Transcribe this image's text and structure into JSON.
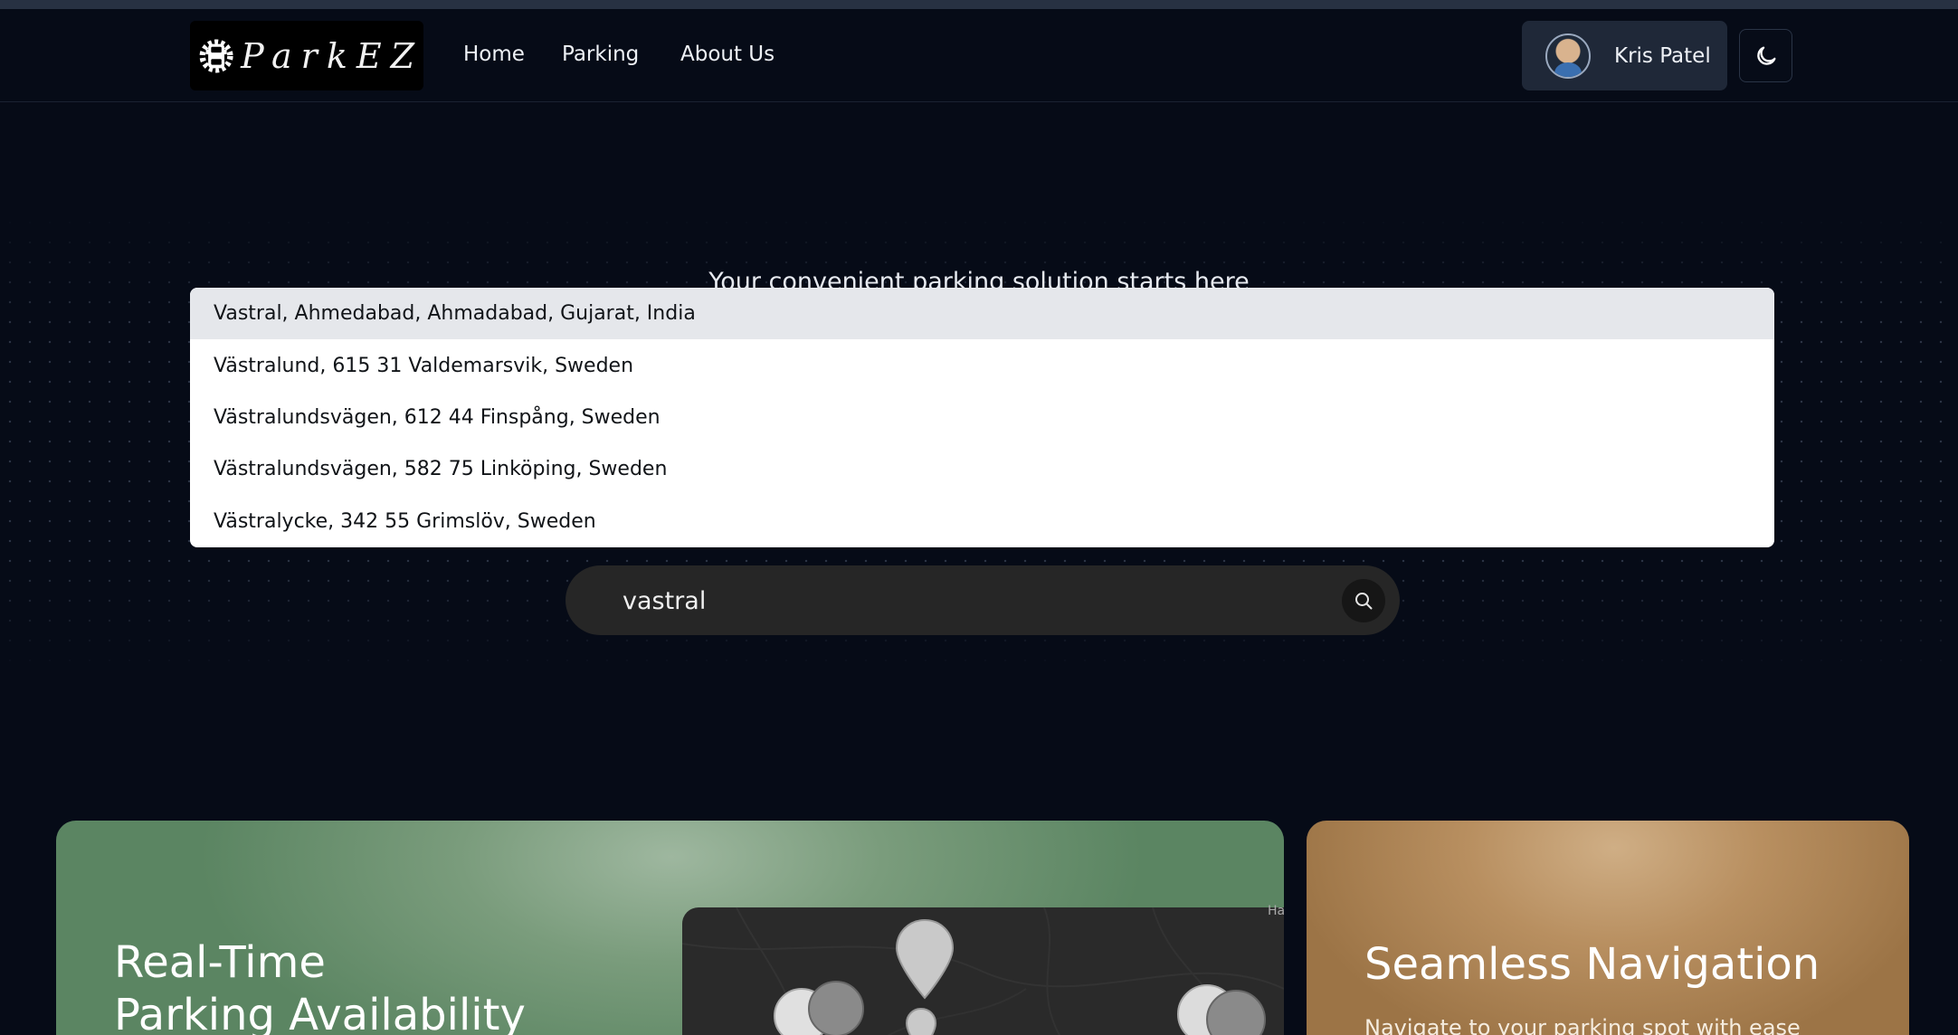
{
  "brand": {
    "logo_text": "ParkEZ"
  },
  "nav": {
    "items": [
      "Home",
      "Parking",
      "About Us"
    ]
  },
  "user": {
    "name": "Kris Patel"
  },
  "hero": {
    "tagline": "Your convenient parking solution starts here"
  },
  "search": {
    "value": "vastral",
    "suggestions": [
      "Vastral, Ahmedabad, Ahmadabad, Gujarat, India",
      "Västralund, 615 31 Valdemarsvik, Sweden",
      "Västralundsvägen, 612 44 Finspång, Sweden",
      "Västralundsvägen, 582 75 Linköping, Sweden",
      "Västralycke, 342 55 Grimslöv, Sweden"
    ]
  },
  "features": {
    "realtime": {
      "title_line1": "Real-Time",
      "title_line2": "Parking Availability",
      "map_attribution": "Ha"
    },
    "navigation": {
      "title": "Seamless Navigation",
      "description": "Navigate to your parking spot with ease"
    }
  },
  "colors": {
    "page_bg": "#060b17",
    "user_chip_bg": "#1f2838",
    "search_bg": "#262626",
    "card_green": "#7a9c7c",
    "card_gold": "#b88f60"
  },
  "icons": {
    "theme_toggle": "moon-icon",
    "search_button": "search-icon"
  }
}
